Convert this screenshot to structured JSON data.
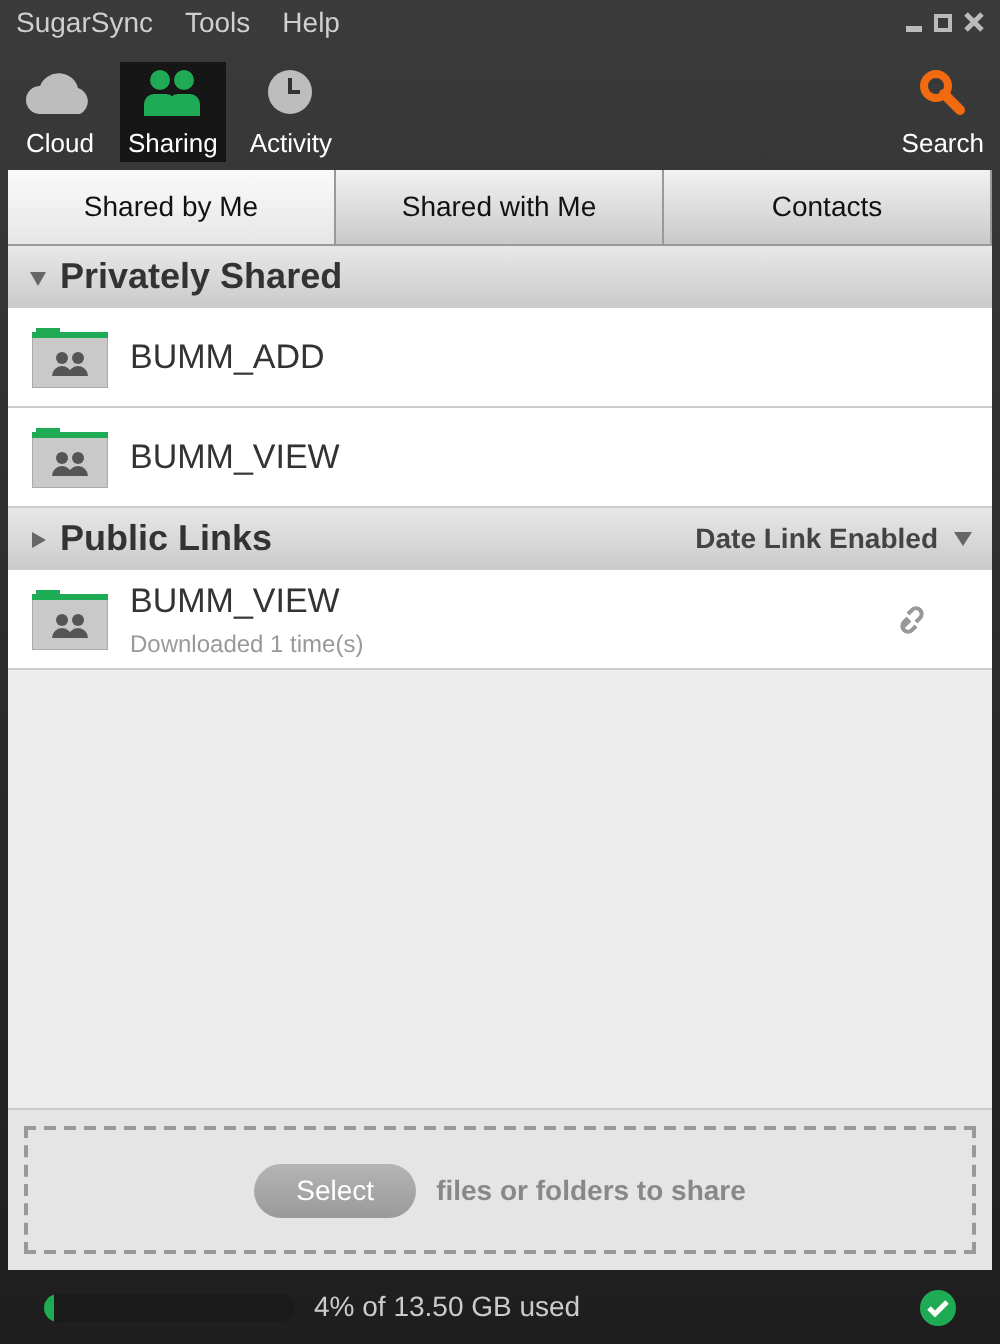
{
  "menu": [
    "SugarSync",
    "Tools",
    "Help"
  ],
  "toolbar": [
    {
      "kind": "cloud",
      "label": "Cloud",
      "selected": false
    },
    {
      "kind": "sharing",
      "label": "Sharing",
      "selected": true
    },
    {
      "kind": "activity",
      "label": "Activity",
      "selected": false
    }
  ],
  "search": {
    "label": "Search"
  },
  "tabs": [
    {
      "label": "Shared by Me",
      "selected": true
    },
    {
      "label": "Shared with Me",
      "selected": false
    },
    {
      "label": "Contacts",
      "selected": false
    }
  ],
  "sections": [
    {
      "title": "Privately Shared",
      "expanded": true,
      "items": [
        {
          "name": "BUMM_ADD"
        },
        {
          "name": "BUMM_VIEW"
        }
      ]
    },
    {
      "title": "Public Links",
      "expanded": false,
      "filter": "Date Link Enabled",
      "items": [
        {
          "name": "BUMM_VIEW",
          "detail": "Downloaded 1 time(s)",
          "link": true
        }
      ]
    }
  ],
  "drop_zone": {
    "button": "Select",
    "text": "files or folders to share"
  },
  "status_bar": {
    "level": 0.04,
    "usage": "4% of 13.50 GB used",
    "synced": true
  }
}
